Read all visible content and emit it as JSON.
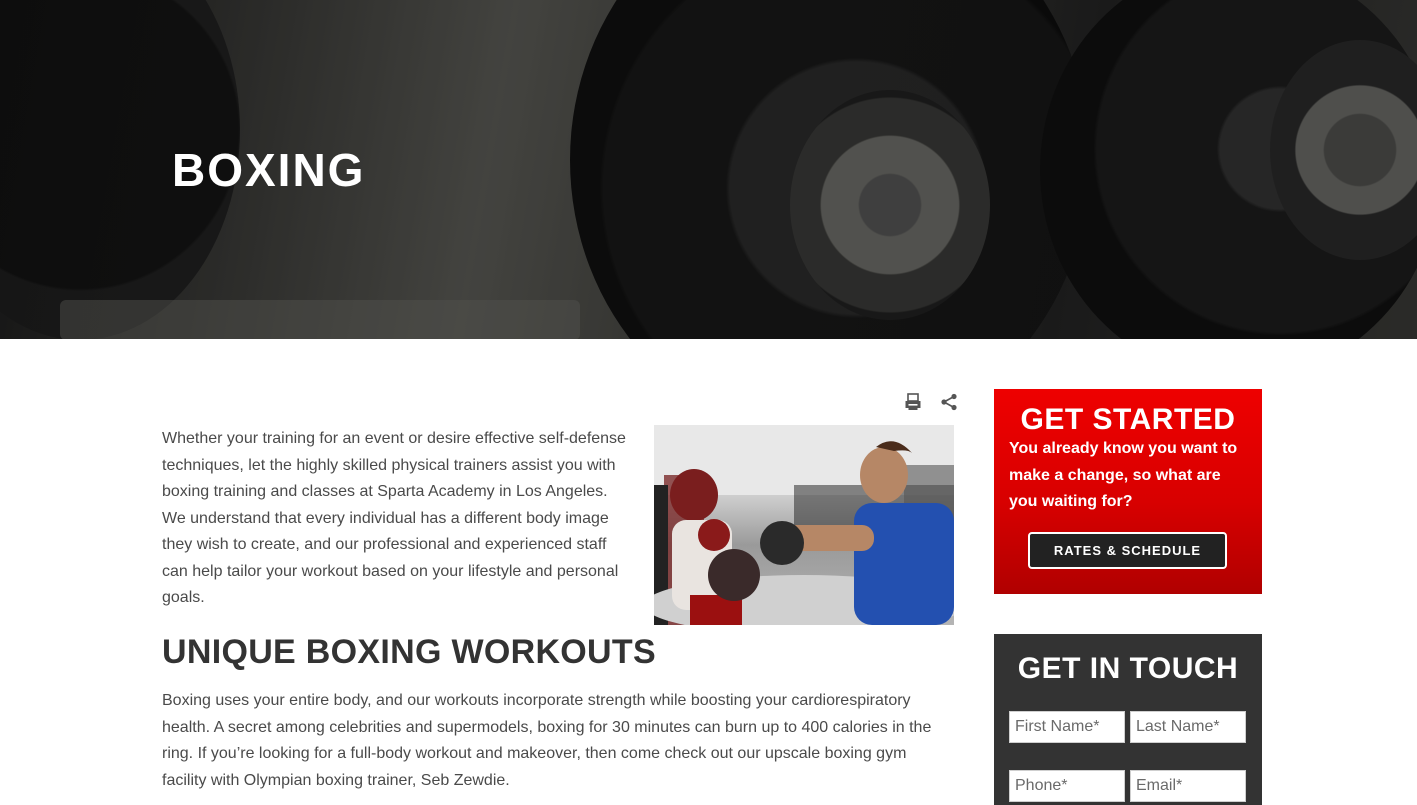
{
  "hero": {
    "title": "BOXING"
  },
  "tools": {
    "print_icon": "print-icon",
    "share_icon": "share-icon"
  },
  "main": {
    "intro": "Whether your training for an event or desire effective self-defense techniques, let the highly skilled physical trainers assist you with boxing training and classes at Sparta Academy in Los Angeles. We understand that every individual has a different body image they wish to create, and our professional and experienced staff can help tailor your workout based on your lifestyle and personal goals.",
    "heading": "UNIQUE BOXING WORKOUTS",
    "body": "Boxing uses your entire body, and our workouts incorporate strength while boosting your cardiorespiratory health. A secret among celebrities and supermodels, boxing for 30 minutes can burn up to 400 calories in the ring. If you’re looking for a full-body workout and makeover, then come check out our upscale boxing gym facility with Olympian boxing trainer, Seb Zewdie."
  },
  "sidebar": {
    "cta": {
      "title": "GET STARTED",
      "text": "You already know you want to make a change, so what are you waiting for?",
      "button": "RATES & SCHEDULE"
    },
    "contact": {
      "title": "GET IN TOUCH",
      "first_name_placeholder": "First Name*",
      "last_name_placeholder": "Last Name*",
      "phone_placeholder": "Phone*",
      "email_placeholder": "Email*"
    }
  },
  "colors": {
    "accent": "#e00000",
    "dark": "#333333",
    "text": "#4a4a4a"
  }
}
